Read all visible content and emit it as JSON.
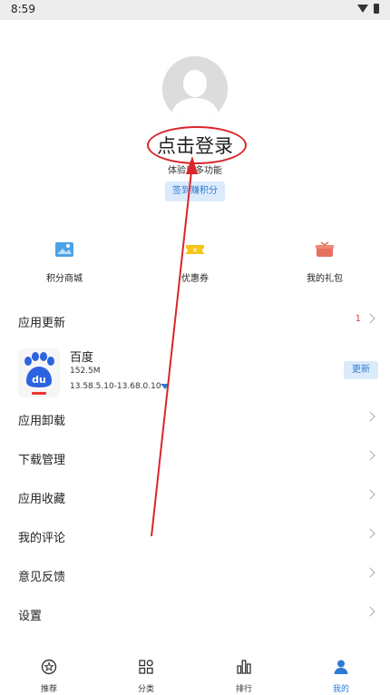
{
  "status_bar": {
    "time": "8:59"
  },
  "profile": {
    "login_text": "点击登录",
    "subtitle": "体验更多功能",
    "signin_label": "签到赚积分"
  },
  "quick_actions": [
    {
      "label": "积分商城",
      "icon": "image-gift-icon",
      "color": "#4aa3e8"
    },
    {
      "label": "优惠券",
      "icon": "coupon-icon",
      "color": "#f5c518"
    },
    {
      "label": "我的礼包",
      "icon": "gift-box-icon",
      "color": "#e8705e"
    }
  ],
  "menu": {
    "app_update": {
      "label": "应用更新",
      "count": "1"
    },
    "uninstall": "应用卸载",
    "download_manage": "下载管理",
    "favorites": "应用收藏",
    "my_comments": "我的评论",
    "feedback": "意见反馈",
    "settings": "设置"
  },
  "update_app": {
    "name": "百度",
    "size": "152.5M",
    "version": "13.58.5.10-13.68.0.10",
    "button": "更新",
    "icon": "baidu-paw-icon"
  },
  "tabs": [
    {
      "label": "推荐",
      "icon": "star-circle-icon",
      "active": false
    },
    {
      "label": "分类",
      "icon": "category-icon",
      "active": false
    },
    {
      "label": "排行",
      "icon": "ranking-icon",
      "active": false
    },
    {
      "label": "我的",
      "icon": "person-icon",
      "active": true
    }
  ],
  "colors": {
    "accent": "#2d7ad4",
    "annotation": "#d9262c",
    "badge": "#e53935"
  }
}
